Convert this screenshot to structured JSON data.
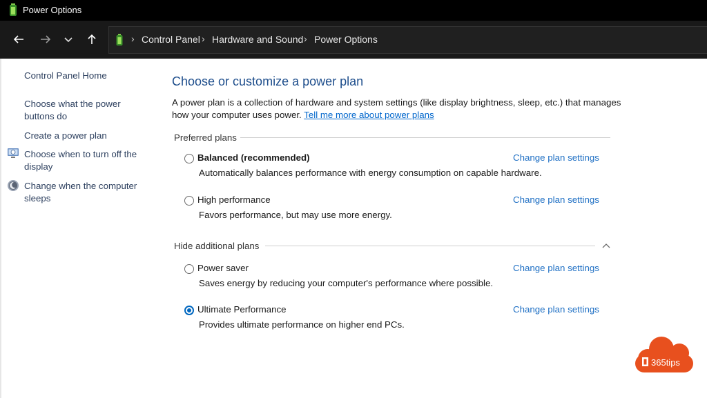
{
  "window": {
    "title": "Power Options"
  },
  "breadcrumb": [
    "Control Panel",
    "Hardware and Sound",
    "Power Options"
  ],
  "left_pane": {
    "home": "Control Panel Home",
    "links": [
      "Choose what the power buttons do",
      "Create a power plan",
      "Choose when to turn off the display",
      "Change when the computer sleeps"
    ]
  },
  "main": {
    "heading": "Choose or customize a power plan",
    "description": "A power plan is a collection of hardware and system settings (like display brightness, sleep, etc.) that manages how your computer uses power.",
    "more_link": "Tell me more about power plans",
    "preferred_label": "Preferred plans",
    "additional_label": "Hide additional plans",
    "change_label": "Change plan settings",
    "plans": [
      {
        "name": "Balanced (recommended)",
        "desc": "Automatically balances performance with energy consumption on capable hardware.",
        "selected": false
      },
      {
        "name": "High performance",
        "desc": "Favors performance, but may use more energy.",
        "selected": false
      },
      {
        "name": "Power saver",
        "desc": "Saves energy by reducing your computer's performance where possible.",
        "selected": false
      },
      {
        "name": "Ultimate Performance",
        "desc": "Provides ultimate performance on higher end PCs.",
        "selected": true
      }
    ]
  },
  "watermark": {
    "text": "365tips",
    "color": "#e8501e"
  },
  "colors": {
    "accent": "#0067c0",
    "heading": "#1e4e8c",
    "link": "#1e6fc4"
  }
}
